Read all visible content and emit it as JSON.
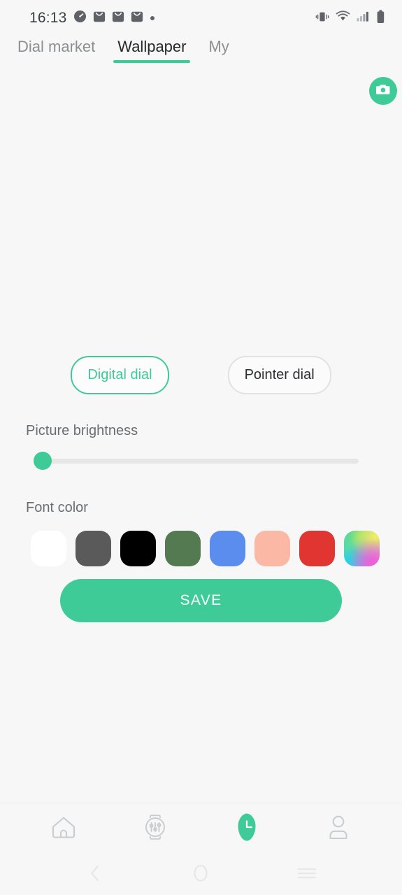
{
  "theme": {
    "accent": "#3ecb98",
    "background": "#f7f7f7",
    "text_primary": "#26282b",
    "text_secondary": "#6b6e71",
    "tab_inactive": "#8c8f92"
  },
  "status_bar": {
    "time": "16:13",
    "left_icons": [
      "speedometer-icon",
      "mail-icon",
      "mail-icon",
      "mail-icon",
      "dot-icon"
    ],
    "right_icons": [
      "vibrate-icon",
      "wifi-icon",
      "signal-icon",
      "battery-icon"
    ]
  },
  "tabs": [
    {
      "label": "Dial market",
      "active": false
    },
    {
      "label": "Wallpaper",
      "active": true
    },
    {
      "label": "My",
      "active": false
    }
  ],
  "preview": {
    "camera_button_icon": "camera-icon"
  },
  "dial_types": [
    {
      "label": "Digital dial",
      "selected": true
    },
    {
      "label": "Pointer dial",
      "selected": false
    }
  ],
  "brightness": {
    "label": "Picture brightness",
    "value": 0,
    "min": 0,
    "max": 100
  },
  "font_color": {
    "label": "Font color",
    "swatches": [
      {
        "name": "white",
        "color": "#ffffff"
      },
      {
        "name": "gray",
        "color": "#5a5a5a"
      },
      {
        "name": "black",
        "color": "#000000"
      },
      {
        "name": "green",
        "color": "#547a52"
      },
      {
        "name": "blue",
        "color": "#5b8def"
      },
      {
        "name": "peach",
        "color": "#fbb8a5"
      },
      {
        "name": "red",
        "color": "#e03530"
      },
      {
        "name": "rainbow",
        "color": "gradient"
      }
    ],
    "selected_index": null
  },
  "save_button": {
    "label": "SAVE"
  },
  "app_nav": [
    {
      "name": "home",
      "icon": "home-icon",
      "active": false
    },
    {
      "name": "device",
      "icon": "watch-settings-icon",
      "active": false
    },
    {
      "name": "dial",
      "icon": "watch-clock-icon",
      "active": true
    },
    {
      "name": "profile",
      "icon": "person-icon",
      "active": false
    }
  ],
  "system_nav": [
    {
      "name": "back",
      "icon": "chevron-left-icon"
    },
    {
      "name": "home",
      "icon": "circle-icon"
    },
    {
      "name": "recents",
      "icon": "menu-lines-icon"
    }
  ]
}
